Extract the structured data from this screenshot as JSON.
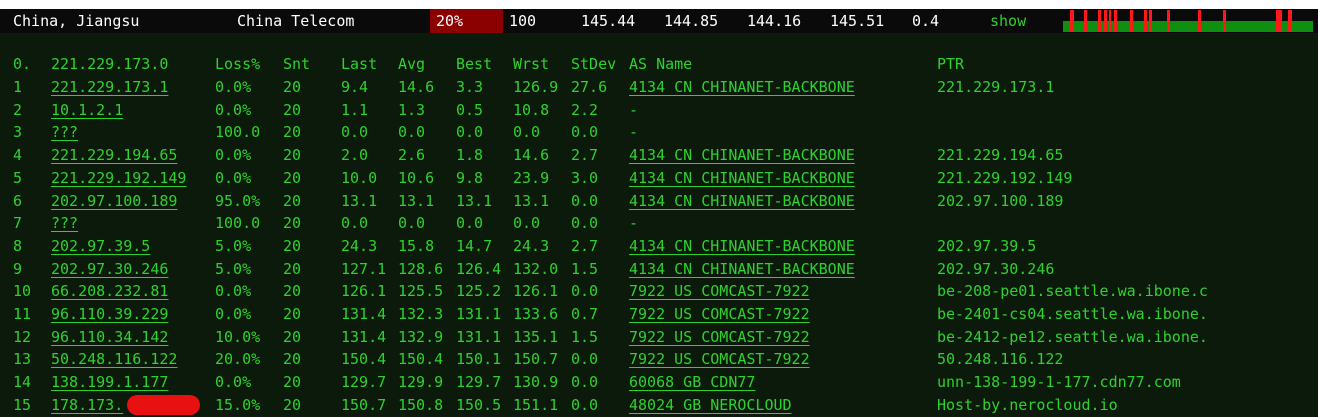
{
  "summary": {
    "location": "China, Jiangsu",
    "isp": "China Telecom",
    "loss": "20%",
    "sent": "100",
    "last": "145.44",
    "avg": "144.85",
    "best": "144.16",
    "worst": "145.51",
    "stdev": "0.4",
    "show_label": "show",
    "loss_color": "#8b0000",
    "graph_bar_color_ok": "#0f8f0f",
    "graph_bar_color_loss": "#ff1a1a"
  },
  "table": {
    "header": {
      "hop": "0.",
      "host": "221.229.173.0",
      "loss": "Loss%",
      "snt": "Snt",
      "last": "Last",
      "avg": "Avg",
      "best": "Best",
      "wrst": "Wrst",
      "stdev": "StDev",
      "asname": "AS Name",
      "ptr": "PTR"
    },
    "rows": [
      {
        "hop": "1",
        "host": "221.229.173.1",
        "loss": "0.0%",
        "snt": "20",
        "last": "9.4",
        "avg": "14.6",
        "best": "3.3",
        "wrst": "126.9",
        "stdev": "27.6",
        "asname": "4134  CN CHINANET-BACKBONE",
        "ptr": "221.229.173.1"
      },
      {
        "hop": "2",
        "host": "10.1.2.1",
        "loss": "0.0%",
        "snt": "20",
        "last": "1.1",
        "avg": "1.3",
        "best": "0.5",
        "wrst": "10.8",
        "stdev": "2.2",
        "asname": "-",
        "ptr": ""
      },
      {
        "hop": "3",
        "host": "???",
        "loss": "100.0",
        "snt": "20",
        "last": "0.0",
        "avg": "0.0",
        "best": "0.0",
        "wrst": "0.0",
        "stdev": "0.0",
        "asname": "-",
        "ptr": ""
      },
      {
        "hop": "4",
        "host": "221.229.194.65",
        "loss": "0.0%",
        "snt": "20",
        "last": "2.0",
        "avg": "2.6",
        "best": "1.8",
        "wrst": "14.6",
        "stdev": "2.7",
        "asname": "4134  CN CHINANET-BACKBONE",
        "ptr": "221.229.194.65"
      },
      {
        "hop": "5",
        "host": "221.229.192.149",
        "loss": "0.0%",
        "snt": "20",
        "last": "10.0",
        "avg": "10.6",
        "best": "9.8",
        "wrst": "23.9",
        "stdev": "3.0",
        "asname": "4134  CN CHINANET-BACKBONE",
        "ptr": "221.229.192.149"
      },
      {
        "hop": "6",
        "host": "202.97.100.189",
        "loss": "95.0%",
        "snt": "20",
        "last": "13.1",
        "avg": "13.1",
        "best": "13.1",
        "wrst": "13.1",
        "stdev": "0.0",
        "asname": "4134  CN CHINANET-BACKBONE",
        "ptr": "202.97.100.189"
      },
      {
        "hop": "7",
        "host": "???",
        "loss": "100.0",
        "snt": "20",
        "last": "0.0",
        "avg": "0.0",
        "best": "0.0",
        "wrst": "0.0",
        "stdev": "0.0",
        "asname": "-",
        "ptr": ""
      },
      {
        "hop": "8",
        "host": "202.97.39.5",
        "loss": "5.0%",
        "snt": "20",
        "last": "24.3",
        "avg": "15.8",
        "best": "14.7",
        "wrst": "24.3",
        "stdev": "2.7",
        "asname": "4134  CN CHINANET-BACKBONE",
        "ptr": "202.97.39.5"
      },
      {
        "hop": "9",
        "host": "202.97.30.246",
        "loss": "5.0%",
        "snt": "20",
        "last": "127.1",
        "avg": "128.6",
        "best": "126.4",
        "wrst": "132.0",
        "stdev": "1.5",
        "asname": "4134  CN CHINANET-BACKBONE",
        "ptr": "202.97.30.246"
      },
      {
        "hop": "10",
        "host": "66.208.232.81",
        "loss": "0.0%",
        "snt": "20",
        "last": "126.1",
        "avg": "125.5",
        "best": "125.2",
        "wrst": "126.1",
        "stdev": "0.0",
        "asname": "7922  US COMCAST-7922",
        "ptr": "be-208-pe01.seattle.wa.ibone.c"
      },
      {
        "hop": "11",
        "host": "96.110.39.229",
        "loss": "0.0%",
        "snt": "20",
        "last": "131.4",
        "avg": "132.3",
        "best": "131.1",
        "wrst": "133.6",
        "stdev": "0.7",
        "asname": "7922  US COMCAST-7922",
        "ptr": "be-2401-cs04.seattle.wa.ibone."
      },
      {
        "hop": "12",
        "host": "96.110.34.142",
        "loss": "10.0%",
        "snt": "20",
        "last": "131.4",
        "avg": "132.9",
        "best": "131.1",
        "wrst": "135.1",
        "stdev": "1.5",
        "asname": "7922  US COMCAST-7922",
        "ptr": "be-2412-pe12.seattle.wa.ibone."
      },
      {
        "hop": "13",
        "host": "50.248.116.122",
        "loss": "20.0%",
        "snt": "20",
        "last": "150.4",
        "avg": "150.4",
        "best": "150.1",
        "wrst": "150.7",
        "stdev": "0.0",
        "asname": "7922  US COMCAST-7922",
        "ptr": "50.248.116.122"
      },
      {
        "hop": "14",
        "host": "138.199.1.177",
        "loss": "0.0%",
        "snt": "20",
        "last": "129.7",
        "avg": "129.9",
        "best": "129.7",
        "wrst": "130.9",
        "stdev": "0.0",
        "asname": "60068 GB CDN77",
        "ptr": "unn-138-199-1-177.cdn77.com"
      },
      {
        "hop": "15",
        "host": "178.173.",
        "loss": "15.0%",
        "snt": "20",
        "last": "150.7",
        "avg": "150.8",
        "best": "150.5",
        "wrst": "151.1",
        "stdev": "0.0",
        "asname": "48024 GB NEROCLOUD",
        "ptr": "Host-by.nerocloud.io"
      }
    ]
  }
}
